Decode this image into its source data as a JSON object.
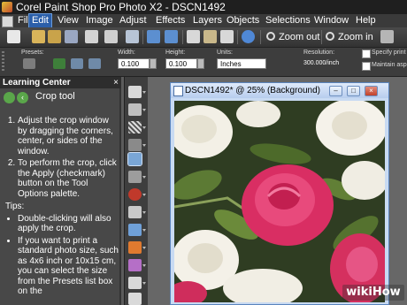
{
  "app": {
    "title": "Corel Paint Shop Pro Photo X2 - DSCN1492"
  },
  "menu": {
    "items": [
      {
        "label": "File"
      },
      {
        "label": "Edit",
        "selected": true
      },
      {
        "label": "View"
      },
      {
        "label": "Image"
      },
      {
        "label": "Adjust"
      },
      {
        "label": "Effects"
      },
      {
        "label": "Layers"
      },
      {
        "label": "Objects"
      },
      {
        "label": "Selections"
      },
      {
        "label": "Window"
      },
      {
        "label": "Help"
      }
    ]
  },
  "toolbar": {
    "zoom_out_label": "Zoom out",
    "zoom_in_label": "Zoom in",
    "icons": [
      "new-file-icon",
      "open-folder-icon",
      "browse-icon",
      "save-icon",
      "save-as-icon",
      "print-icon",
      "undo-icon",
      "redo-icon",
      "copy-icon",
      "paste-icon",
      "history-icon",
      "info-icon"
    ]
  },
  "tool_options": {
    "presets_label": "Presets:",
    "width_label": "Width:",
    "width_value": "0.100",
    "height_label": "Height:",
    "height_value": "0.100",
    "units_label": "Units:",
    "units_value": "Inches",
    "resolution_label": "Resolution:",
    "resolution_value": "300.000/inch",
    "specify_print_label": "Specify print",
    "maintain_aspect_label": "Maintain asp"
  },
  "learning_center": {
    "header": "Learning Center",
    "title": "Crop tool",
    "steps": [
      "Adjust the crop window by dragging the corners, center, or sides of the window.",
      "To perform the crop, click the Apply (checkmark) button on the Tool Options palette."
    ],
    "tips_label": "Tips:",
    "tips": [
      "Double-clicking will also apply the crop.",
      "If you want to print a standard photo size, such as 4x6 inch or 10x15 cm, you can select the size from the Presets list box on the"
    ]
  },
  "document": {
    "title": "DSCN1492* @ 25% (Background)"
  },
  "colors": {
    "accent": "#2b5fa9",
    "doc_frame": "#c8daf2",
    "rose_pink": "#e0336a",
    "rose_white": "#f4f1e8",
    "leaf_green": "#5c7a34"
  },
  "watermark": "wikiHow"
}
